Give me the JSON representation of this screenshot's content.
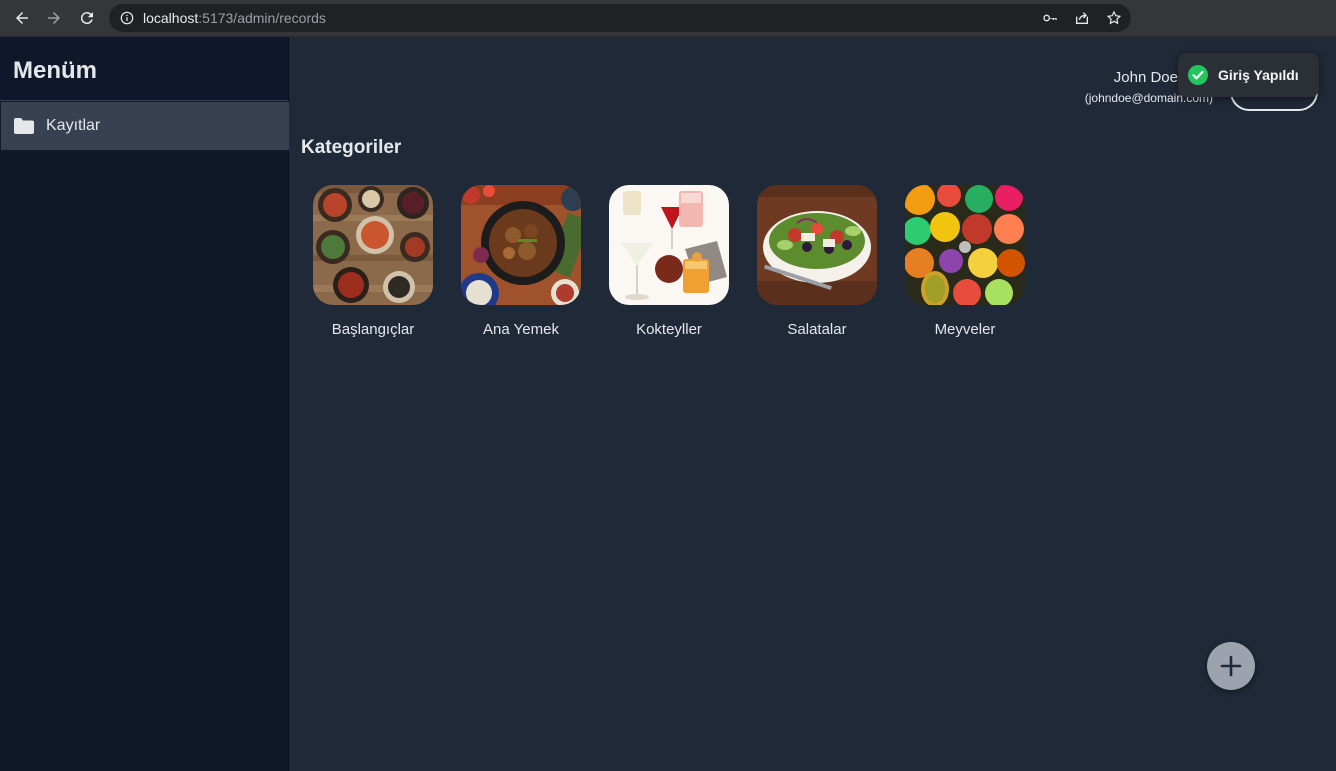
{
  "browser": {
    "url_host": "localhost",
    "url_rest": ":5173/admin/records"
  },
  "sidebar": {
    "title": "Menüm",
    "items": [
      {
        "label": "Kayıtlar",
        "icon": "folder-icon"
      }
    ]
  },
  "header": {
    "user_name": "John Doe",
    "user_email": "(johndoe@domain.com)"
  },
  "toast": {
    "message": "Giriş Yapıldı",
    "icon": "check-circle-icon"
  },
  "main": {
    "section_title": "Kategoriler",
    "categories": [
      {
        "label": "Başlangıçlar"
      },
      {
        "label": "Ana Yemek"
      },
      {
        "label": "Kokteyller"
      },
      {
        "label": "Salatalar"
      },
      {
        "label": "Meyveler"
      }
    ]
  },
  "fab": {
    "icon": "plus-icon"
  },
  "colors": {
    "sidebar_bg": "#111827",
    "main_bg": "#1f2937",
    "active_item": "#374151",
    "toast_success": "#22c55e"
  }
}
